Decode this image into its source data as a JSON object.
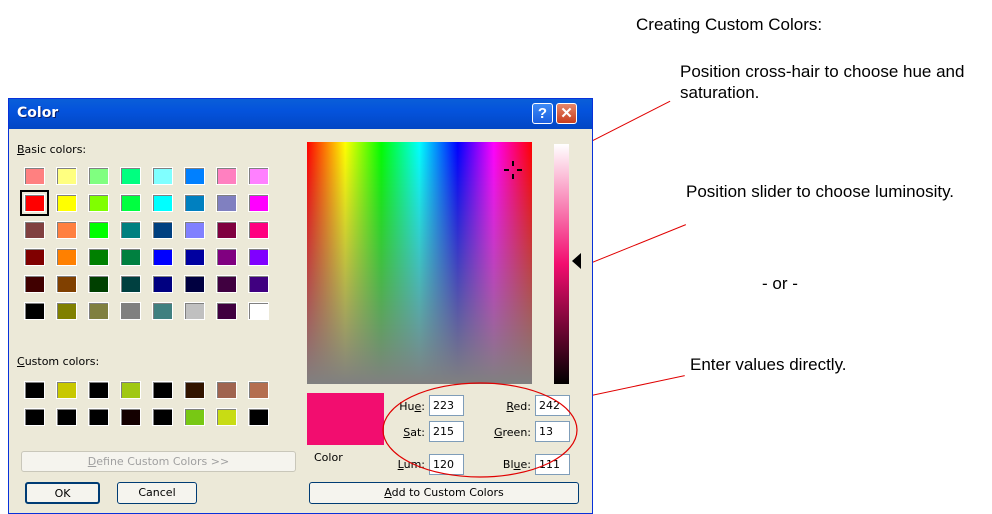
{
  "annotations": {
    "heading": "Creating Custom Colors:",
    "crosshair": "Position cross-hair to choose hue and saturation.",
    "slider": "Position slider to choose luminosity.",
    "or": "- or -",
    "values": "Enter values directly."
  },
  "dialog": {
    "title": "Color",
    "help_label": "?",
    "close_label": "✕",
    "basic_colors_label": "Basic colors:",
    "custom_colors_label": "Custom colors:",
    "define_button": "Define Custom Colors >>",
    "ok_button": "OK",
    "cancel_button": "Cancel",
    "preview_label": "Color",
    "add_button": "Add to Custom Colors",
    "fields": {
      "hue": {
        "label": "Hue:",
        "value": "223"
      },
      "sat": {
        "label": "Sat:",
        "value": "215"
      },
      "lum": {
        "label": "Lum:",
        "value": "120"
      },
      "red": {
        "label": "Red:",
        "value": "242"
      },
      "green": {
        "label": "Green:",
        "value": "13"
      },
      "blue": {
        "label": "Blue:",
        "value": "111"
      }
    },
    "basic_colors": [
      [
        "#ff8080",
        "#ffff80",
        "#80ff80",
        "#00ff80",
        "#80ffff",
        "#0080ff",
        "#ff80c0",
        "#ff80ff"
      ],
      [
        "#ff0000",
        "#ffff00",
        "#80ff00",
        "#00ff40",
        "#00ffff",
        "#0080c0",
        "#8080c0",
        "#ff00ff"
      ],
      [
        "#804040",
        "#ff8040",
        "#00ff00",
        "#008080",
        "#004080",
        "#8080ff",
        "#800040",
        "#ff0080"
      ],
      [
        "#800000",
        "#ff8000",
        "#008000",
        "#008040",
        "#0000ff",
        "#0000a0",
        "#800080",
        "#8000ff"
      ],
      [
        "#400000",
        "#804000",
        "#004000",
        "#004040",
        "#000080",
        "#000040",
        "#400040",
        "#400080"
      ],
      [
        "#000000",
        "#808000",
        "#808040",
        "#808080",
        "#408080",
        "#c0c0c0",
        "#400040",
        "#ffffff"
      ]
    ],
    "selected_basic": "row-1-col-0",
    "custom_colors": [
      [
        "#000000",
        "#c8c800",
        "#000000",
        "#a0c814",
        "#000000",
        "#321400",
        "#a06450",
        "#b46e50"
      ],
      [
        "#000000",
        "#000000",
        "#000000",
        "#140000",
        "#000000",
        "#78c814",
        "#c8dc14",
        "#000000"
      ]
    ],
    "current_color": "#f20d6f"
  }
}
